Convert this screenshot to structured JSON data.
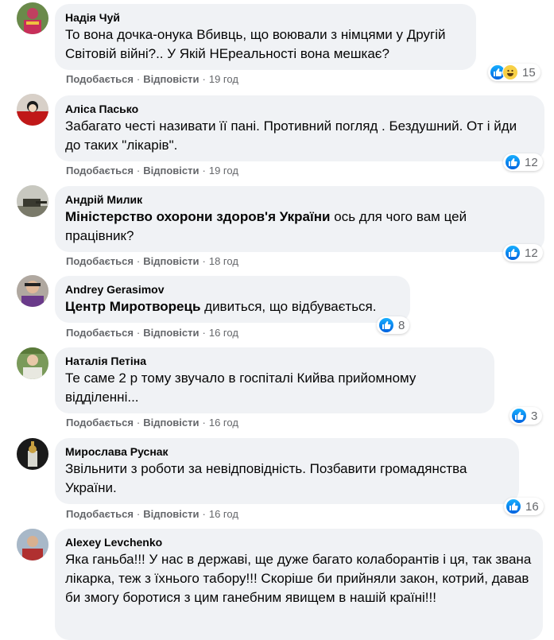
{
  "ui": {
    "like_label": "Подобається",
    "reply_label": "Відповісти",
    "separator": "·"
  },
  "comments": [
    {
      "author": "Надія Чуй",
      "text": "То вона дочка-онука Вбивць, що воювали з німцями у Другій Світовій війні?.. У Якій НЕреальності вона мешкає?",
      "time": "19 год",
      "reactions": [
        "like-icon",
        "haha-icon"
      ],
      "count": "15"
    },
    {
      "author": "Аліса Пасько",
      "text": "Забагато честі називати її пані. Противний погляд . Бездушний. От і йди до таких \"лікарів\".",
      "time": "19 год",
      "reactions": [
        "like-icon"
      ],
      "count": "12"
    },
    {
      "author": "Андрій Милик",
      "tag": "Міністерство охорони здоров'я України",
      "text": " ось для чого вам цей працівник?",
      "time": "18 год",
      "reactions": [
        "like-icon"
      ],
      "count": "12"
    },
    {
      "author": "Andrey Gerasimov",
      "tag": "Центр Миротворець",
      "text": " дивиться, що відбувається.",
      "time": "16 год",
      "reactions": [
        "like-icon"
      ],
      "count": "8"
    },
    {
      "author": "Наталія Петіна",
      "text": "Те саме 2 р тому звучало в госпіталі Кийва прийомному відділенні...",
      "time": "16 год",
      "reactions": [
        "like-icon"
      ],
      "count": "3"
    },
    {
      "author": "Мирослава Руснак",
      "text": "Звільнити з роботи за невідповідність. Позбавити громадянства України.",
      "time": "16 год",
      "reactions": [
        "like-icon"
      ],
      "count": "16"
    },
    {
      "author": "Alexey Levchenko",
      "text": "Яка ганьба!!! У нас в державі, ще дуже багато колаборантів і ця, так звана лікарка, теж з їхнього табору!!! Скоріше би прийняли закон, котрий, давав би змогу боротися з цим ганебним явищем в нашій країні!!!"
    }
  ],
  "colors": {
    "bubble": "#f0f2f5",
    "meta": "#65676b",
    "like_blue": "#1877f2"
  }
}
